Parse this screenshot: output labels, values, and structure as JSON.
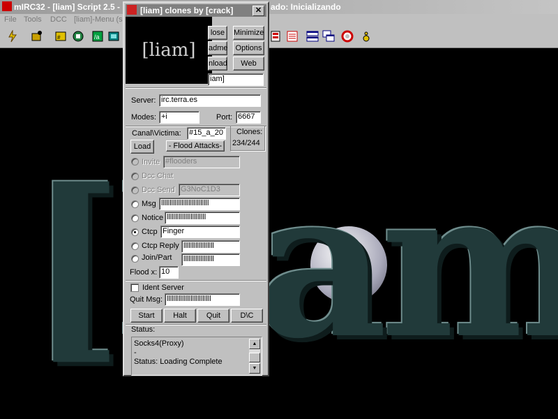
{
  "main_window": {
    "title": "mIRC32 - [liam] Script 2.5 -",
    "title_right": "ado: Inicializando"
  },
  "menu": [
    "File",
    "Tools",
    "DCC",
    "[liam]-Menu (sa"
  ],
  "clones_window": {
    "title": "[liam] clones by [crack]",
    "close_glyph": "✕",
    "logo_text": "[liam]",
    "top_buttons": [
      "lose",
      "Minimize",
      "adme",
      "Options",
      "nload",
      "Web"
    ],
    "name_field": "iam]",
    "server_label": "Server:",
    "server_value": "irc.terra.es",
    "modes_label": "Modes:",
    "modes_value": "+i",
    "port_label": "Port:",
    "port_value": "6667",
    "canal_label": "Canal\\Victima:",
    "canal_value": "#15_a_20",
    "clones_label": "Clones:",
    "clones_value": "234/244",
    "load_button": "Load",
    "flood_button": "- Flood Attacks-",
    "invite_label": "Invite",
    "invite_value": "#flooders",
    "dcc_chat_label": "Dcc Chat",
    "dcc_send_label": "Dcc Send",
    "dcc_send_value": "G3NoC1D3",
    "msg_label": "Msg",
    "msg_value": "llllllllllllllllllllllllllll",
    "notice_label": "Notice",
    "notice_value": "lllllllllllllllllllllll",
    "ctcp_label": "Ctcp",
    "ctcp_value": "Finger",
    "ctcp_reply_label": "Ctcp Reply",
    "ctcp_reply_value": "llllllllllllllllll",
    "join_part_label": "Join/Part",
    "join_part_value": "llllllllllllllllll",
    "flood_x_label": "Flood x:",
    "flood_x_value": "10",
    "ident_label": "Ident Server",
    "quit_msg_label": "Quit Msg:",
    "quit_msg_value": "llllllllllllllllllllllllll",
    "bottom_buttons": [
      "Start",
      "Halt",
      "Quit",
      "D\\C"
    ],
    "status_label": "Status:",
    "status_lines": [
      "Socks4(Proxy)",
      "-",
      "Status: Loading Complete"
    ]
  },
  "background_text": "[liam"
}
